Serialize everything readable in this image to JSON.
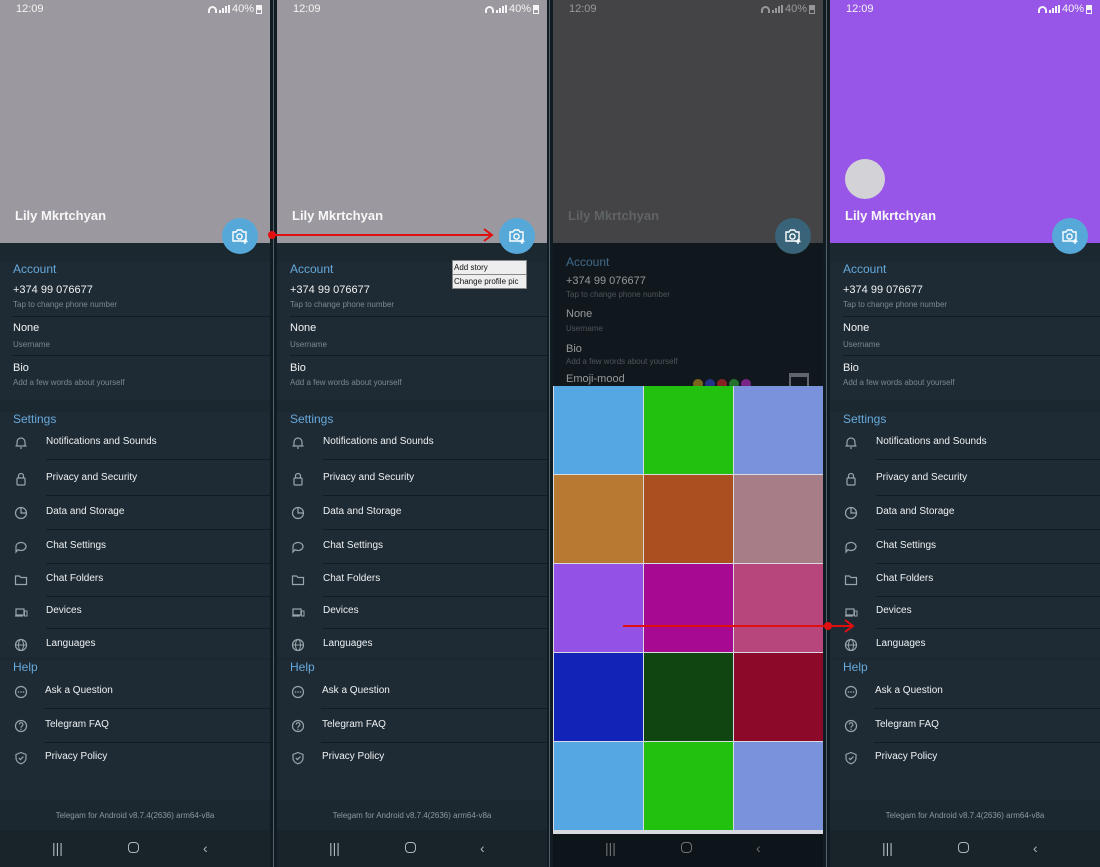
{
  "status": {
    "time": "12:09",
    "battery": "40%"
  },
  "profile": {
    "name": "Lily Mkrtchyan"
  },
  "account": {
    "title": "Account",
    "phone": "+374 99 076677",
    "phone_hint": "Tap to change phone number",
    "username": "None",
    "username_hint": "Username",
    "bio": "Bio",
    "bio_hint": "Add a few words about yourself",
    "emoji_mood": "Emoji-mood"
  },
  "settings": {
    "title": "Settings",
    "items": [
      {
        "label": "Notifications and Sounds",
        "icon": "bell-icon"
      },
      {
        "label": "Privacy and Security",
        "icon": "lock-icon"
      },
      {
        "label": "Data and Storage",
        "icon": "pie-chart-icon"
      },
      {
        "label": "Chat Settings",
        "icon": "chat-bubble-icon"
      },
      {
        "label": "Chat Folders",
        "icon": "folder-icon"
      },
      {
        "label": "Devices",
        "icon": "devices-icon"
      },
      {
        "label": "Languages",
        "icon": "globe-icon"
      }
    ]
  },
  "help": {
    "title": "Help",
    "items": [
      {
        "label": "Ask a Question",
        "icon": "chat-dots-icon"
      },
      {
        "label": "Telegram FAQ",
        "icon": "question-circle-icon"
      },
      {
        "label": "Privacy Policy",
        "icon": "shield-check-icon"
      }
    ]
  },
  "footer": {
    "version": "Telegam for Android v8.7.4(2636) arm64-v8a"
  },
  "popup": {
    "items": [
      "Add story",
      "Change profile pic"
    ]
  },
  "color_picker": {
    "colors": [
      "#55a7e4",
      "#22c10f",
      "#7a91dc",
      "#b87932",
      "#ab4f20",
      "#a77d88",
      "#9451e6",
      "#a60a93",
      "#b6467c",
      "#1224b7",
      "#0e4510",
      "#8c0929",
      "#55a7e4",
      "#22c10f",
      "#7a91dc"
    ]
  },
  "colors": {
    "accent": "#55a8d7",
    "header_gray": "#9b999f",
    "header_purple": "#9856e8",
    "arrow": "#e01010"
  }
}
